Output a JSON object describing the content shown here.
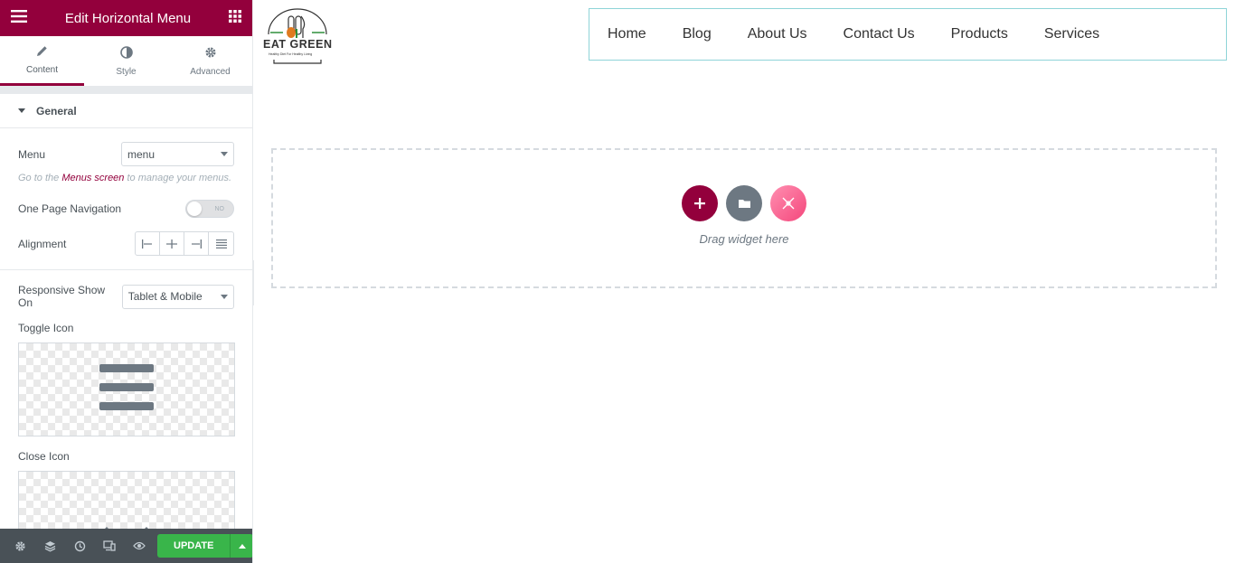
{
  "panel": {
    "title": "Edit Horizontal Menu",
    "tabs": [
      {
        "label": "Content"
      },
      {
        "label": "Style"
      },
      {
        "label": "Advanced"
      }
    ],
    "section_title": "General",
    "menu_label": "Menu",
    "menu_value": "menu",
    "hint_prefix": "Go to the",
    "hint_link": "Menus screen",
    "hint_suffix": "to manage your menus.",
    "one_page_label": "One Page Navigation",
    "toggle_text": "NO",
    "alignment_label": "Alignment",
    "responsive_label": "Responsive Show On",
    "responsive_value": "Tablet & Mobile",
    "toggle_icon_label": "Toggle Icon",
    "close_icon_label": "Close Icon",
    "update_label": "UPDATE"
  },
  "preview": {
    "logo_text": "EAT GREEN",
    "logo_tagline": "Healthy Diet For Healthy Living",
    "menu_items": [
      "Home",
      "Blog",
      "About Us",
      "Contact Us",
      "Products",
      "Services"
    ],
    "drop_text": "Drag widget here"
  },
  "colors": {
    "brand": "#93003c",
    "update_green": "#39b54a",
    "folder_gray": "#6d7882",
    "pink": "#ff7aa8",
    "menu_border": "#8fd4d8"
  }
}
